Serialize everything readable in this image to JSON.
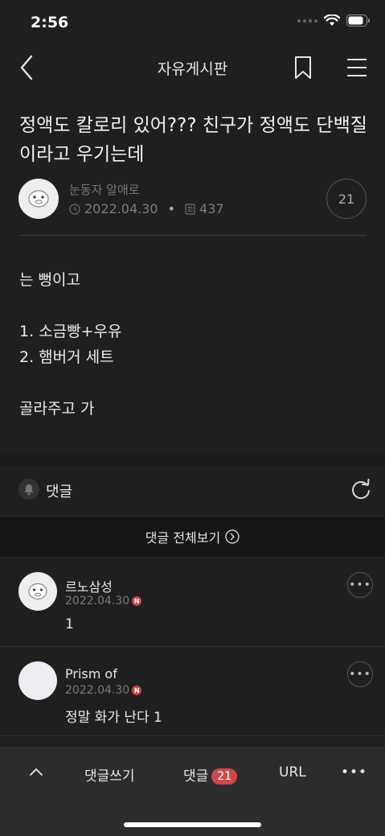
{
  "status": {
    "time": "2:56"
  },
  "header": {
    "title": "자유게시판",
    "back_icon": "chevron-left-icon",
    "bookmark_icon": "bookmark-icon",
    "menu_icon": "hamburger-menu-icon"
  },
  "post": {
    "title": "정액도 칼로리 있어??? 친구가 정액도 단백질이라고 우기는데",
    "author": "눈동자 알애로",
    "date": "2022.04.30",
    "views": "437",
    "comment_count": "21",
    "body": [
      "는 뻥이고",
      "1. 소금빵+우유",
      "2. 햄버거 세트",
      "골라주고 가"
    ]
  },
  "comments_section": {
    "label": "댓글",
    "view_all": "댓글 전체보기",
    "items": [
      {
        "name": "르노삼성",
        "date": "2022.04.30",
        "badge": "N",
        "text": "1"
      },
      {
        "name": "Prism of",
        "date": "2022.04.30",
        "badge": "N",
        "text": "정말 화가 난다 1"
      }
    ]
  },
  "bottom_bar": {
    "write_comment": "댓글쓰기",
    "comments": "댓글",
    "comments_count": "21",
    "url": "URL",
    "more": "•••"
  },
  "colors": {
    "background": "#1f1f1f",
    "accent_red": "#c94b4b"
  }
}
